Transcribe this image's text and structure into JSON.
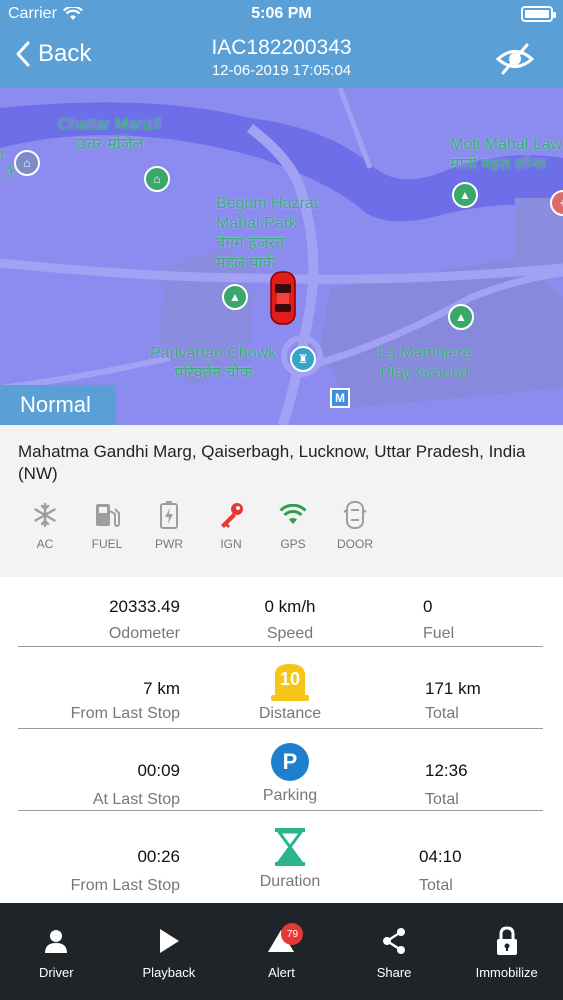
{
  "status_bar": {
    "carrier": "Carrier",
    "time": "5:06 PM"
  },
  "nav": {
    "back_label": "Back",
    "title": "IAC182200343",
    "subtitle": "12-06-2019 17:05:04"
  },
  "map": {
    "labels": {
      "chattar_en": "Chattar Manzil",
      "chattar_hi": "छतर मंज़िल",
      "begum_en1": "Begum Hazrat",
      "begum_en2": "Mahal Park",
      "begum_hi1": "बेगम हज़रत",
      "begum_hi2": "महल पार्क",
      "moti_en": "Moti Mahal Law",
      "moti_hi": "मोती महल लॉन्स",
      "parivartan_en": "Parivartan Chowk",
      "parivartan_hi": "परिवर्तन चौक",
      "martiniere_en1": "La Martiniere",
      "martiniere_en2": "Play Ground",
      "edge_left1": "t",
      "edge_left2": "ौ"
    },
    "metro": "M",
    "mode": "Normal"
  },
  "address": "Mahatma Gandhi Marg, Qaiserbagh, Lucknow, Uttar Pradesh,  India (NW)",
  "sensors": [
    {
      "label": "AC",
      "icon": "snowflake-icon",
      "color": "#9e9e9e"
    },
    {
      "label": "FUEL",
      "icon": "fuel-icon",
      "color": "#9e9e9e"
    },
    {
      "label": "PWR",
      "icon": "battery-icon",
      "color": "#9e9e9e"
    },
    {
      "label": "IGN",
      "icon": "key-icon",
      "color": "#e53935"
    },
    {
      "label": "GPS",
      "icon": "wifi-signal-icon",
      "color": "#2e9e4f"
    },
    {
      "label": "DOOR",
      "icon": "car-door-icon",
      "color": "#9e9e9e"
    }
  ],
  "stats": {
    "odometer": {
      "value": "20333.49",
      "label": "Odometer"
    },
    "speed": {
      "value": "0 km/h",
      "label": "Speed"
    },
    "fuel": {
      "value": "0",
      "label": "Fuel"
    },
    "distance": {
      "left_value": "7 km",
      "left_label": "From Last Stop",
      "icon_text": "10",
      "label": "Distance",
      "right_value": "171 km",
      "right_label": "Total"
    },
    "parking": {
      "left_value": "00:09",
      "left_label": "At Last Stop",
      "icon_text": "P",
      "label": "Parking",
      "right_value": "12:36",
      "right_label": "Total"
    },
    "duration": {
      "left_value": "00:26",
      "left_label": "From Last Stop",
      "label": "Duration",
      "right_value": "04:10",
      "right_label": "Total"
    }
  },
  "tabs": [
    {
      "label": "Driver",
      "icon": "person-icon"
    },
    {
      "label": "Playback",
      "icon": "play-icon"
    },
    {
      "label": "Alert",
      "icon": "alert-icon",
      "badge": "79"
    },
    {
      "label": "Share",
      "icon": "share-icon"
    },
    {
      "label": "Immobilize",
      "icon": "lock-icon"
    }
  ],
  "colors": {
    "header": "#5aa0d6",
    "map": "#8c8cf0",
    "tabbar": "#1f2428",
    "badge": "#e53935"
  }
}
